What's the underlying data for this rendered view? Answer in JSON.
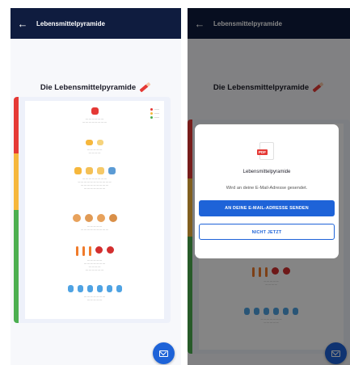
{
  "app": {
    "title": "Lebensmittelpyramide",
    "back_icon": "arrow-left-icon",
    "header_color": "#0f1c3f"
  },
  "page": {
    "title": "Die Lebensmittelpyramide",
    "title_icon": "pencil-icon"
  },
  "pyramid": {
    "band_colors": [
      "#e53935",
      "#f6b73c",
      "#4caf50"
    ]
  },
  "fab": {
    "icon": "mail-icon",
    "color": "#1e63d8"
  },
  "dialog": {
    "icon": "pdf-file-icon",
    "icon_label": "PDF",
    "title": "Lebensmittelpyramide",
    "text": "Wird an deine E-Mail-Adresse gesendet.",
    "send_label": "AN DEINE E-MAIL-ADRESSE SENDEN",
    "later_label": "NICHT JETZT"
  }
}
